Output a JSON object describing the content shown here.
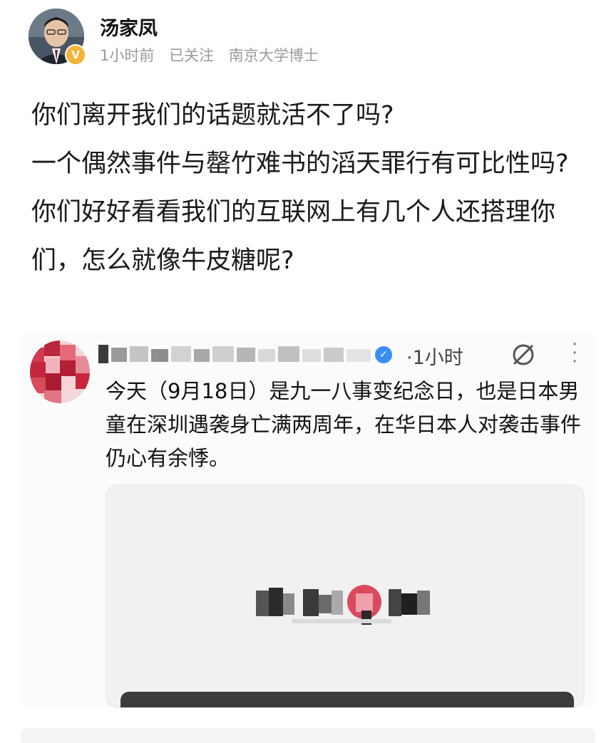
{
  "author": {
    "name": "汤家凤",
    "badge": "V",
    "time": "1小时前",
    "follow_status": "已关注",
    "description": "南京大学博士"
  },
  "post": {
    "lines": [
      "你们离开我们的话题就活不了吗?",
      "一个偶然事件与罄竹难书的滔天罪行有可比性吗?",
      "你们好好看看我们的互联网上有几个人还搭理你们，怎么就像牛皮糖呢?"
    ]
  },
  "quoted": {
    "time": "·1小时",
    "text": "今天（9月18日）是九一八事变纪念日，也是日本男童在深圳遇袭身亡满两周年，在华日本人对袭击事件仍心有余悸。",
    "icons": {
      "verified": "verified-icon",
      "compass": "compass-icon",
      "more": "more-icon"
    }
  },
  "colors": {
    "badge": "#f3b43a",
    "verified": "#3a8ef6",
    "accent_red": "#c8263a"
  }
}
